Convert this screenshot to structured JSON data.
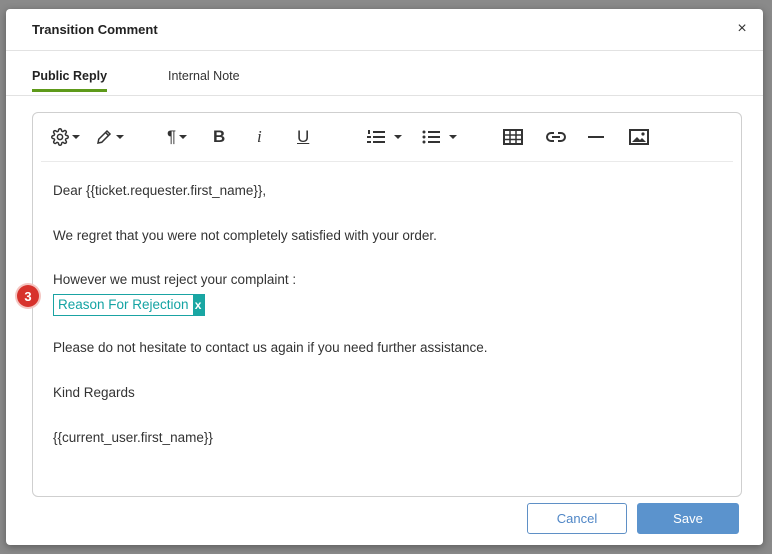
{
  "modal": {
    "title": "Transition Comment",
    "close_label": "×"
  },
  "tabs": [
    {
      "label": "Public Reply",
      "active": true
    },
    {
      "label": "Internal Note",
      "active": false
    }
  ],
  "toolbar": {
    "icons": [
      "gear-icon",
      "pen-icon",
      "paragraph-icon",
      "bold-icon",
      "italic-icon",
      "underline-icon",
      "ordered-list-icon",
      "unordered-list-icon",
      "table-icon",
      "link-icon",
      "horizontal-rule-icon",
      "image-icon"
    ],
    "paragraph_glyph": "¶",
    "bold_glyph": "B",
    "italic_glyph": "i",
    "underline_glyph": "U"
  },
  "body": {
    "greeting": "Dear {{ticket.requester.first_name}},",
    "line1": "We regret that you were not completely satisfied with your order.",
    "line2": "However we must reject your complaint :",
    "placeholder_field": "Reason For Rejection",
    "placeholder_remove": "x",
    "line3": "Please do not hesitate to contact us again if you need further assistance.",
    "signoff": "Kind Regards",
    "signature": "{{current_user.first_name}}"
  },
  "step_badge": "3",
  "buttons": {
    "cancel": "Cancel",
    "save": "Save"
  },
  "colors": {
    "accent_tab": "#5e9a1a",
    "chip": "#19a7a3",
    "badge": "#d7322c",
    "primary": "#5b93cd"
  }
}
